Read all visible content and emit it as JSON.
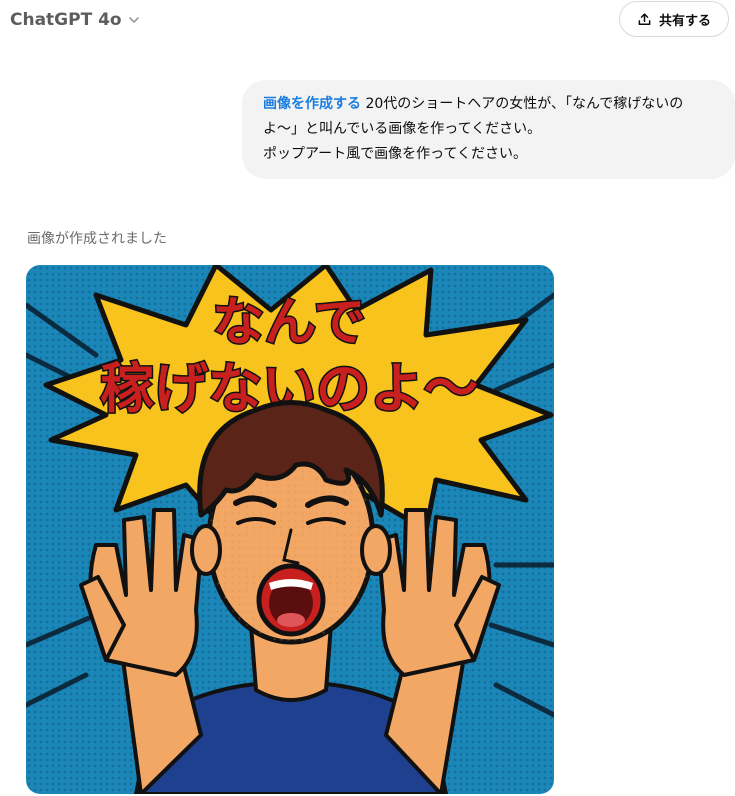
{
  "header": {
    "model_name": "ChatGPT 4o",
    "model_switch_icon": "chevron-down-icon",
    "share_label": "共有する",
    "share_icon": "share-upload-icon"
  },
  "conversation": {
    "user_message": {
      "tool_tag": "画像を作成する",
      "line1": "20代のショートヘアの女性が、「なんで稼げないの",
      "line2": "よ〜」と叫んでいる画像を作ってください。",
      "line3": "ポップアート風で画像を作ってください。"
    },
    "assistant": {
      "status": "画像が作成されました",
      "image": {
        "caption_line1": "なんで",
        "caption_line2": "稼げないのよ〜",
        "colors": {
          "background": "#1b86b8",
          "burst": "#f7c31c",
          "text": "#c8201e",
          "skin": "#f2a765",
          "hair": "#5a2418",
          "shirt": "#1f3f8f",
          "outline": "#111111"
        }
      }
    }
  }
}
